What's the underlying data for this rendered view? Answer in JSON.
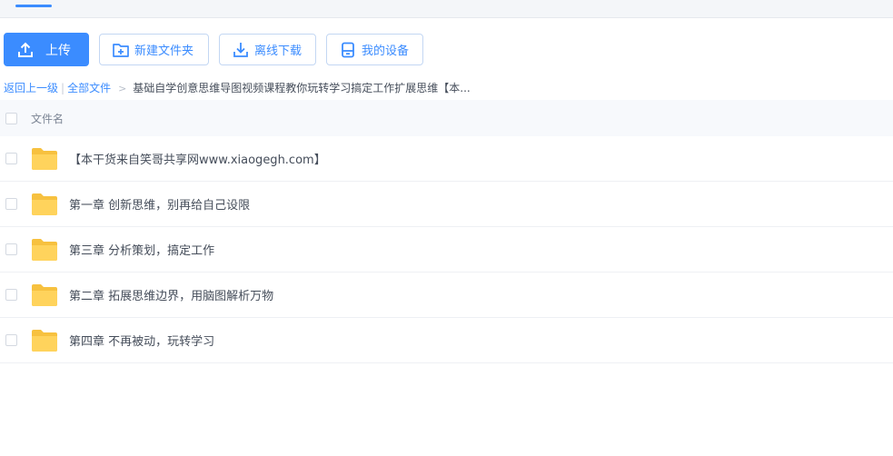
{
  "toolbar": {
    "upload_label": "上传",
    "new_folder_label": "新建文件夹",
    "offline_download_label": "离线下载",
    "my_devices_label": "我的设备"
  },
  "breadcrumb": {
    "back_label": "返回上一级",
    "separator": "|",
    "all_files_label": "全部文件",
    "arrow": ">",
    "current_label": "基础自学创意思维导图视频课程教你玩转学习搞定工作扩展思维【本..."
  },
  "list": {
    "header_label": "文件名",
    "items": [
      {
        "name": "【本干货来自笑哥共享网www.xiaogegh.com】",
        "icon": "folder-icon"
      },
      {
        "name": "第一章 创新思维，别再给自己设限",
        "icon": "folder-icon"
      },
      {
        "name": "第三章 分析策划，搞定工作",
        "icon": "folder-icon"
      },
      {
        "name": "第二章 拓展思维边界，用脑图解析万物",
        "icon": "folder-icon"
      },
      {
        "name": "第四章 不再被动，玩转学习",
        "icon": "folder-icon"
      }
    ]
  },
  "colors": {
    "accent": "#3b8cff",
    "folder": "#ffd35c",
    "folder_dark": "#f7c13f"
  }
}
